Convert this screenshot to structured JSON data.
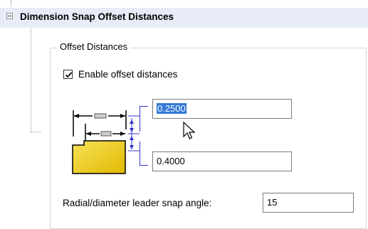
{
  "section": {
    "title": "Dimension Snap Offset Distances",
    "expanded": true
  },
  "group": {
    "legend": "Offset Distances"
  },
  "enable_offset": {
    "label": "Enable offset distances",
    "checked": true
  },
  "offsets": {
    "first": "0.2500",
    "second": "0.4000"
  },
  "leader": {
    "label": "Radial/diameter leader snap angle:",
    "value": "15"
  },
  "colors": {
    "header_bg": "#e8ecf8",
    "bracket": "#3333cc",
    "selection": "#3377d6",
    "part_fill": "#f2d21a"
  }
}
